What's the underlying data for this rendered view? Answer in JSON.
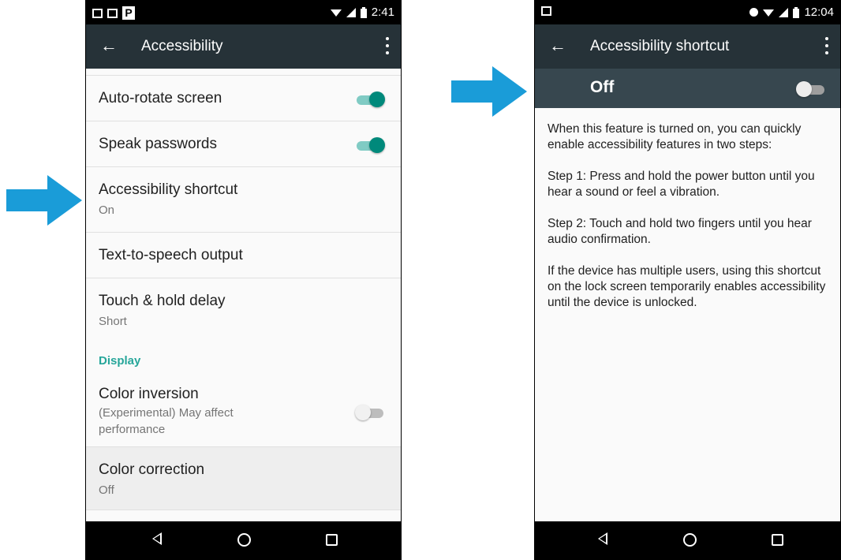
{
  "left_phone": {
    "status": {
      "time": "2:41",
      "notification_letter": "P"
    },
    "appbar": {
      "back_glyph": "←",
      "title": "Accessibility"
    },
    "items": [
      {
        "title": "Auto-rotate screen",
        "toggle": true
      },
      {
        "title": "Speak passwords",
        "toggle": true
      },
      {
        "title": "Accessibility shortcut",
        "summary": "On"
      },
      {
        "title": "Text-to-speech output"
      },
      {
        "title": "Touch & hold delay",
        "summary": "Short"
      }
    ],
    "category": "Display",
    "color_inversion": {
      "title": "Color inversion",
      "summary": "(Experimental) May affect performance",
      "toggle": false
    },
    "color_correction": {
      "title": "Color correction",
      "summary": "Off"
    }
  },
  "right_phone": {
    "status": {
      "time": "12:04"
    },
    "appbar": {
      "back_glyph": "←",
      "title": "Accessibility shortcut"
    },
    "switch": {
      "label": "Off",
      "on": false
    },
    "description": [
      "When this feature is turned on, you can quickly enable accessibility features in two steps:",
      "Step 1: Press and hold the power button until you hear a sound or feel a vibration.",
      "Step 2: Touch and hold two fingers until you hear audio confirmation.",
      "If the device has multiple users, using this shortcut on the lock screen temporarily enables accessibility until the device is unlocked."
    ]
  },
  "colors": {
    "arrow": "#1a9cd8",
    "accent": "#26a69a",
    "appbar": "#263238",
    "switchbar": "#37474f"
  },
  "icons": [
    "arrow-right-icon",
    "back-arrow-icon",
    "overflow-menu-icon",
    "nav-back-icon",
    "nav-home-icon",
    "nav-recents-icon",
    "wifi-icon",
    "signal-icon",
    "battery-icon"
  ]
}
